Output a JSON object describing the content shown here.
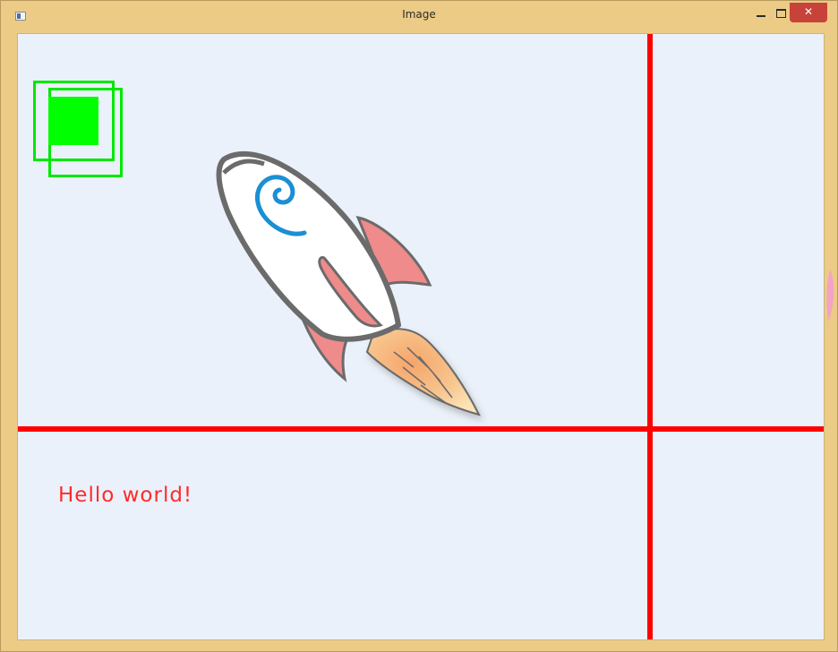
{
  "window": {
    "title": "Image",
    "controls": {
      "minimize": "minimize",
      "maximize": "maximize",
      "close_glyph": "✕"
    },
    "frame_color": "#eccb86",
    "close_color": "#c7433a"
  },
  "canvas": {
    "background": "#ebf1fa",
    "text": "Hello world!",
    "text_color": "#ff2a2a",
    "crosshair_color": "#ff0000",
    "rect_color": "#00ff00",
    "image_icon": "rocket-illustration"
  }
}
